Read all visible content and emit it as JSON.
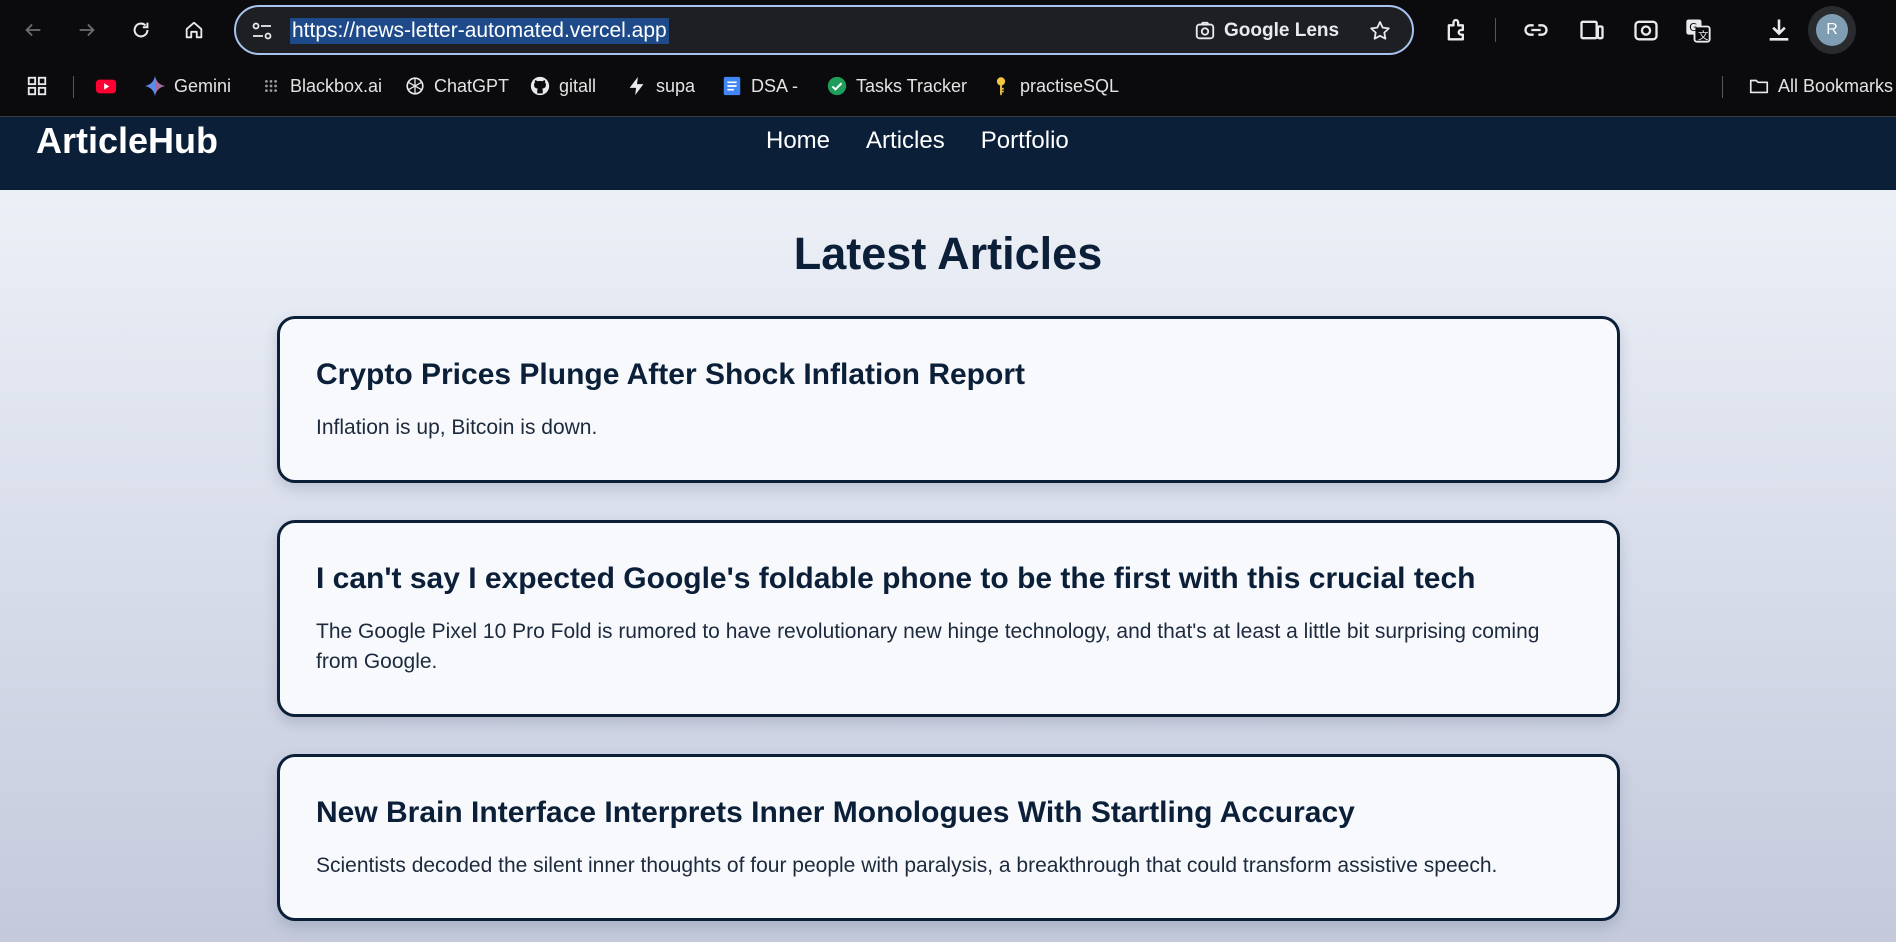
{
  "browser": {
    "url": "https://news-letter-automated.vercel.app",
    "lens_label": "Google Lens",
    "avatar_letter": "R",
    "bookmarks": [
      {
        "label": "",
        "icon": "youtube-icon"
      },
      {
        "label": "Gemini",
        "icon": "gemini-icon"
      },
      {
        "label": "Blackbox.ai",
        "icon": "blackbox-icon"
      },
      {
        "label": "ChatGPT",
        "icon": "chatgpt-icon"
      },
      {
        "label": "gitall",
        "icon": "github-icon"
      },
      {
        "label": "supa",
        "icon": "supabase-icon"
      },
      {
        "label": "DSA -",
        "icon": "docs-icon"
      },
      {
        "label": "Tasks Tracker",
        "icon": "check-circle-icon"
      },
      {
        "label": "practiseSQL",
        "icon": "key-icon"
      }
    ],
    "all_bookmarks_label": "All Bookmarks"
  },
  "site": {
    "logo": "ArticleHub",
    "nav": [
      "Home",
      "Articles",
      "Portfolio"
    ]
  },
  "main": {
    "title": "Latest Articles",
    "articles": [
      {
        "title": "Crypto Prices Plunge After Shock Inflation Report",
        "summary": "Inflation is up, Bitcoin is down."
      },
      {
        "title": "I can't say I expected Google's foldable phone to be the first with this crucial tech",
        "summary": "The Google Pixel 10 Pro Fold is rumored to have revolutionary new hinge technology, and that's at least a little bit surprising coming from Google."
      },
      {
        "title": "New Brain Interface Interprets Inner Monologues With Startling Accuracy",
        "summary": "Scientists decoded the silent inner thoughts of four people with paralysis, a breakthrough that could transform assistive speech."
      }
    ]
  },
  "colors": {
    "header_bg": "#0b1f38",
    "card_border": "#0b1f38",
    "chrome_bg": "#0b0b0d",
    "url_highlight": "#1e4a8a"
  }
}
